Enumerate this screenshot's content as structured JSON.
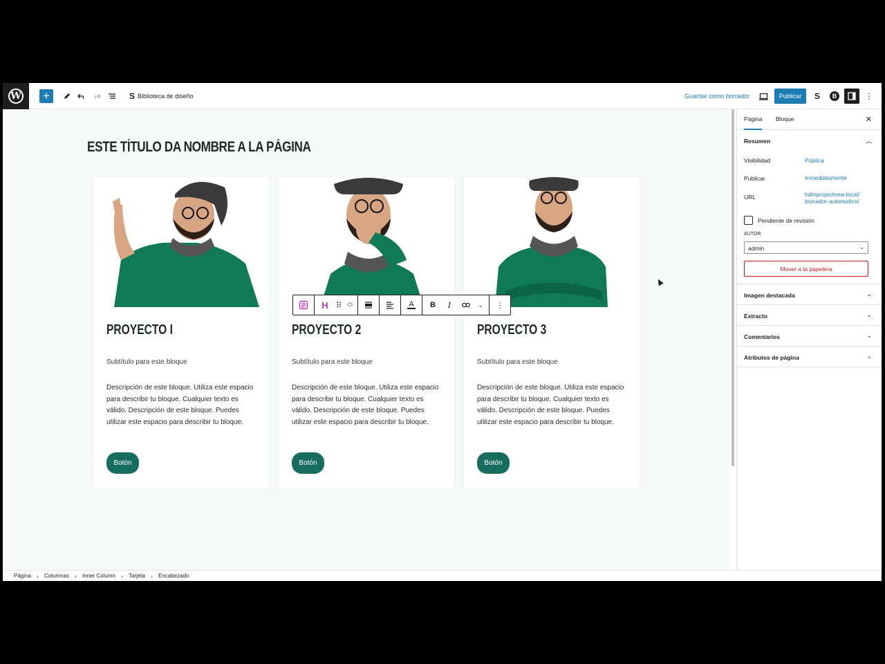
{
  "toolbar": {
    "library_label": "Biblioteca de diseño",
    "save_draft": "Guardar como borrador",
    "publish": "Publicar",
    "b_badge": "B"
  },
  "canvas": {
    "page_title": "Este título da nombre a la página",
    "cards": [
      {
        "title": "Proyecto I",
        "subtitle": "Subtítulo para este bloque",
        "description": "Descripción de este bloque. Utiliza este espacio para describir tu bloque. Cualquier texto es válido. Descripción de este bloque. Puedes utilizar este espacio para describir tu bloque.",
        "button": "Botón"
      },
      {
        "title": "Proyecto 2",
        "subtitle": "Subtítulo para este bloque",
        "description": "Descripción de este bloque. Utiliza este espacio para describir tu bloque. Cualquier texto es válido. Descripción de este bloque. Puedes utilizar este espacio para describir tu bloque.",
        "button": "Botón"
      },
      {
        "title": "Proyecto 3",
        "subtitle": "Subtítulo para este bloque",
        "description": "Descripción de este bloque. Utiliza este espacio para describir tu bloque. Cualquier texto es válido. Descripción de este bloque. Puedes utilizar este espacio para describir tu bloque.",
        "button": "Botón"
      }
    ]
  },
  "breadcrumb": [
    "Página",
    "Columnas",
    "Inner Column",
    "Tarjeta",
    "Encabezado"
  ],
  "sidebar": {
    "tab_page": "Página",
    "tab_block": "Bloque",
    "summary_title": "Resumen",
    "visibility_label": "Visibilidad",
    "visibility_value": "Pública",
    "publish_label": "Publicar",
    "publish_value": "Inmediatamente",
    "url_label": "URL",
    "url_value": "hdmprojectnew.local/ borrador-automatico/",
    "pending_review": "Pendiente de revisión",
    "author_label": "AUTOR",
    "author_value": "admin",
    "trash_button": "Mover a la papelera",
    "panels": [
      "Imagen destacada",
      "Extracto",
      "Comentarios",
      "Atributos de página"
    ]
  },
  "colors": {
    "accent": "#1c7db4",
    "button_green": "#176e5e",
    "sweater_green": "#0f7a55",
    "danger": "#cc1818"
  }
}
